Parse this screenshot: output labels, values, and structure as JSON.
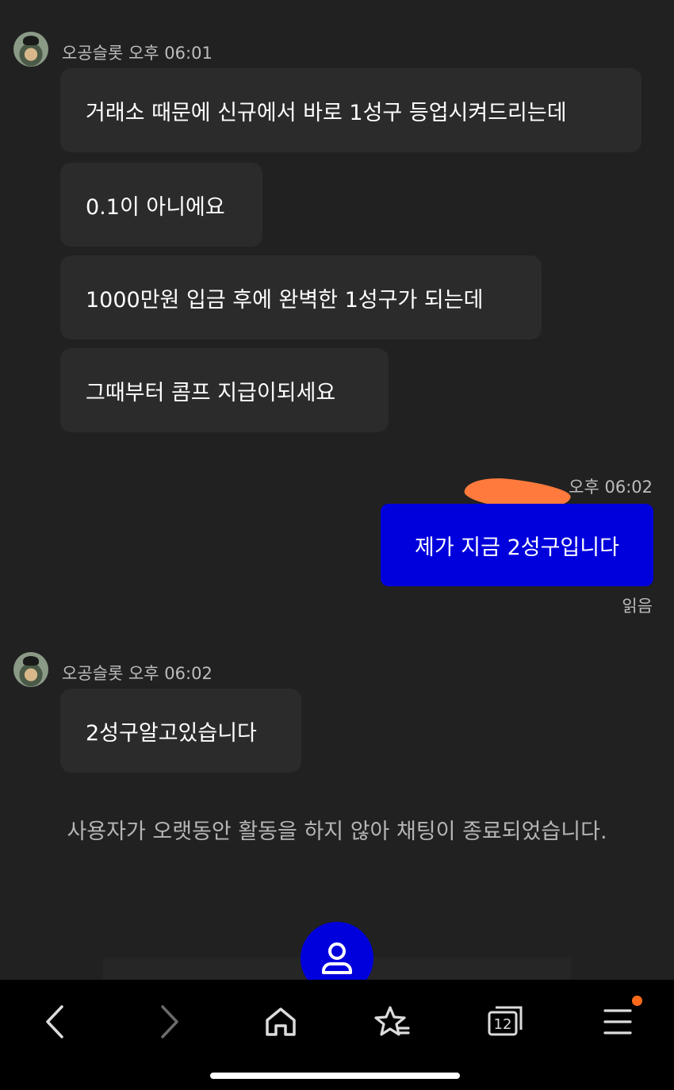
{
  "messages": [
    {
      "sender": "오공슬롯",
      "time": "오후 06:01",
      "bubbles": [
        "거래소 때문에 신규에서 바로 1성구 등업시켜드리는데",
        "0.1이 아니에요",
        "1000만원 입금 후에 완벽한 1성구가 되는데",
        "그때부터 콤프 지급이되세요"
      ]
    },
    {
      "mine": true,
      "time": "오후 06:02",
      "text": "제가 지금 2성구입니다",
      "status": "읽음"
    },
    {
      "sender": "오공슬롯",
      "time": "오후 06:02",
      "bubbles": [
        "2성구알고있습니다"
      ]
    }
  ],
  "system_message": "사용자가 오랫동안 활동을 하지 않아 채팅이 종료되었습니다.",
  "fab_icon": "person-icon",
  "browser_nav": {
    "tab_count": "12",
    "icons": [
      "back-icon",
      "forward-icon",
      "home-icon",
      "bookmarks-icon",
      "tabs-icon",
      "menu-icon"
    ]
  },
  "colors": {
    "background": "#212121",
    "incoming_bubble": "#2b2b2b",
    "outgoing_bubble": "#0000dc",
    "notification_dot": "#ff6a1a"
  }
}
